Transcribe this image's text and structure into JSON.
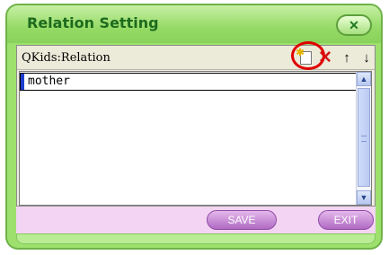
{
  "dialog": {
    "title": "Relation Setting",
    "close_icon": "close-icon",
    "colors": {
      "frame": "#9ee06e",
      "title_text": "#1d6b1d",
      "footer": "#f3d4f2",
      "button": "#b06ac3",
      "highlight": "#e00000"
    }
  },
  "toolbar": {
    "label": "QKids:Relation",
    "buttons": [
      {
        "icon": "new-document-icon"
      },
      {
        "icon": "delete-x-icon"
      },
      {
        "icon": "arrow-up-icon"
      },
      {
        "icon": "arrow-down-icon"
      }
    ]
  },
  "list": {
    "items": [
      "mother"
    ]
  },
  "footer": {
    "save_label": "SAVE",
    "exit_label": "EXIT"
  }
}
